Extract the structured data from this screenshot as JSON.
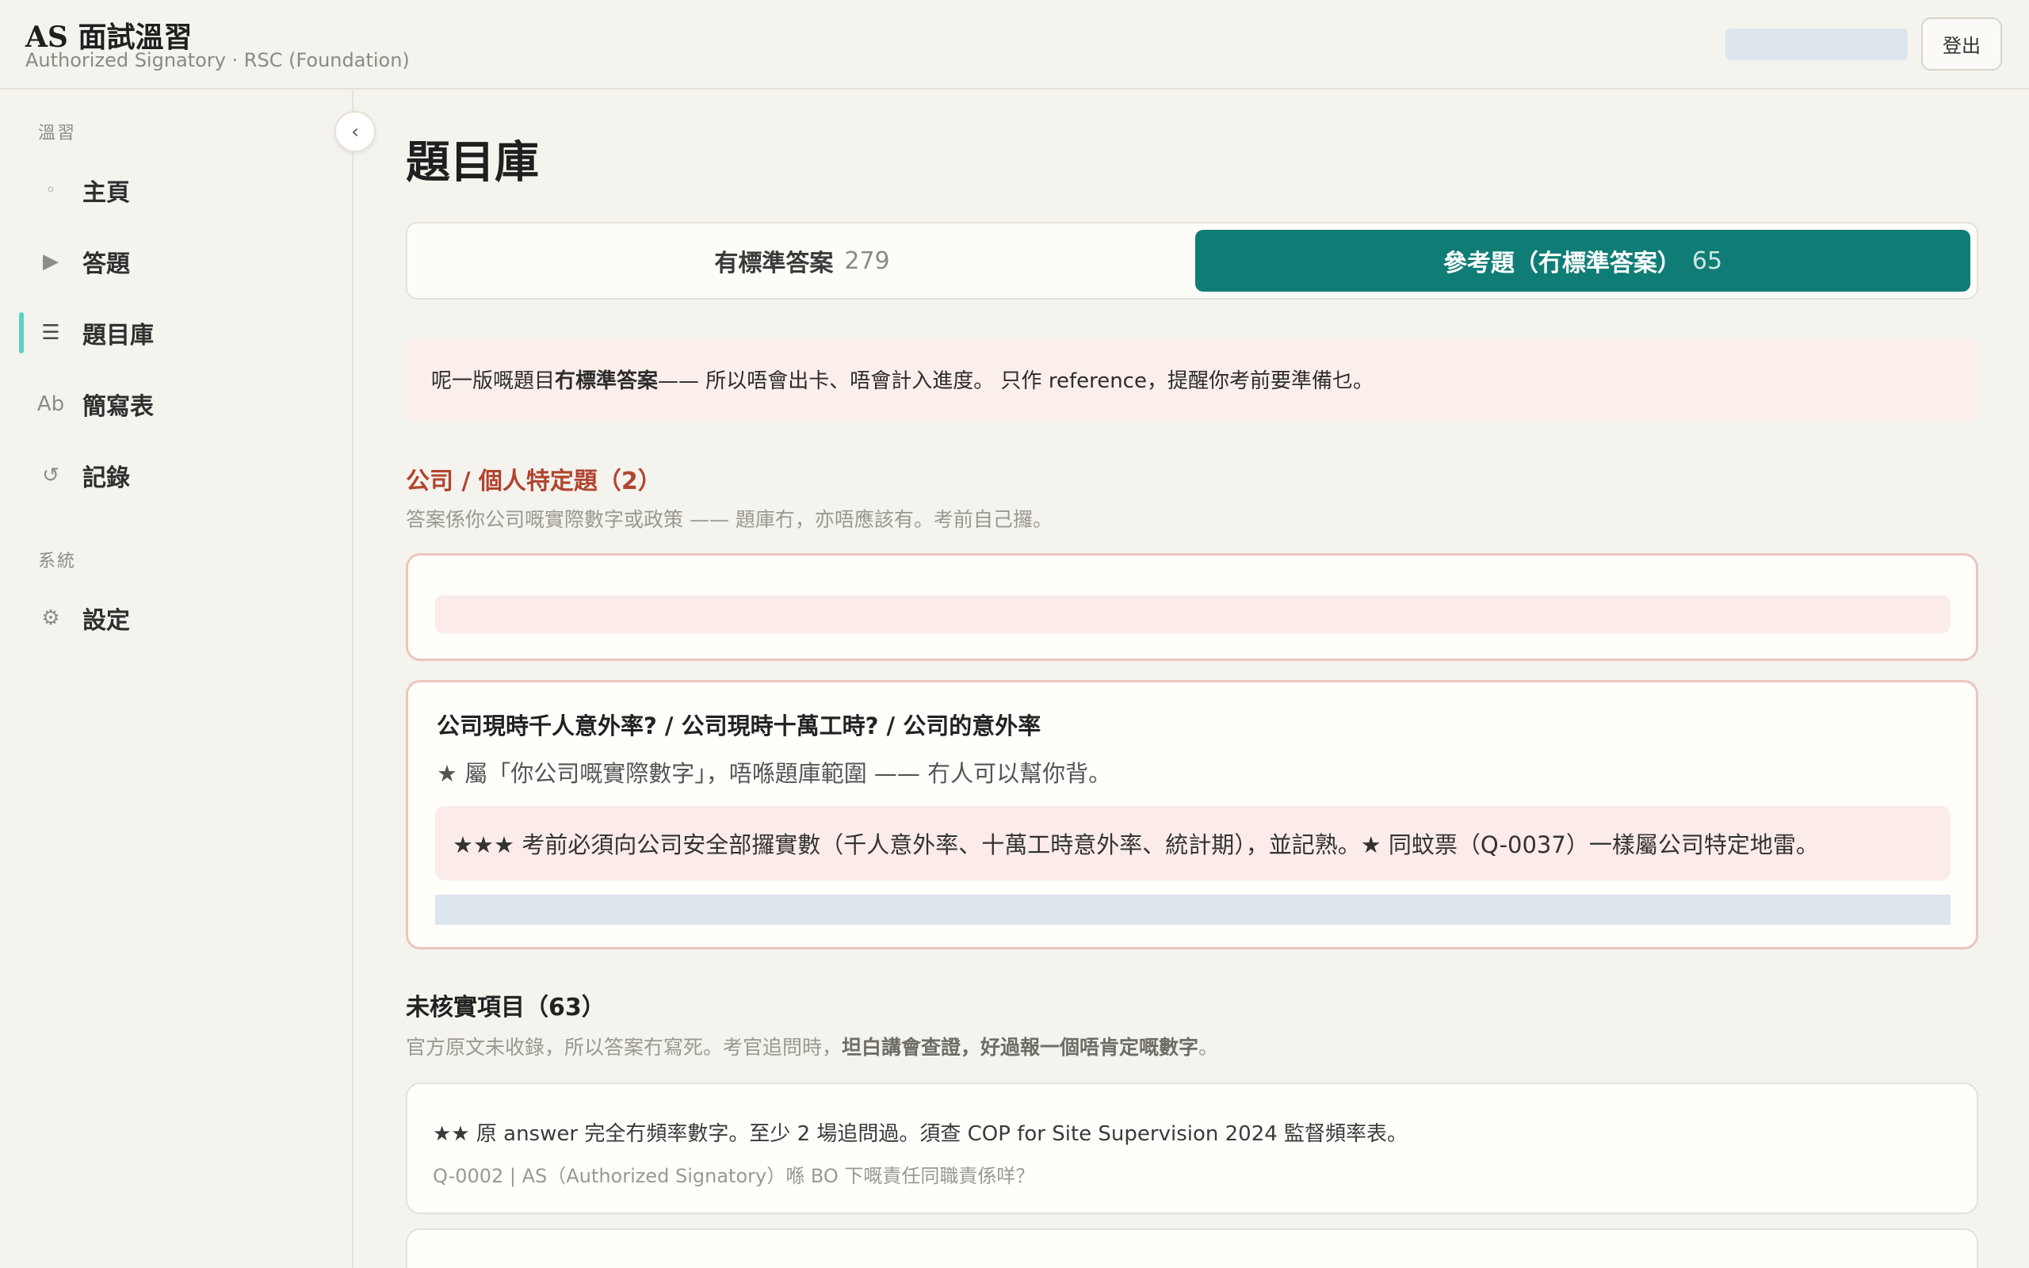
{
  "header": {
    "title": "AS 面試溫習",
    "subtitle": "Authorized Signatory · RSC (Foundation)",
    "logout_label": "登出"
  },
  "sidebar": {
    "section_review": "溫習",
    "section_system": "系統",
    "collapse_glyph": "‹",
    "items": [
      {
        "icon": "◦",
        "icon_name": "home-dot-icon",
        "label": "主頁"
      },
      {
        "icon": "▶",
        "icon_name": "play-icon",
        "label": "答題"
      },
      {
        "icon": "☰",
        "icon_name": "list-icon",
        "label": "題目庫"
      },
      {
        "icon": "Ab",
        "icon_name": "abbreviation-icon",
        "label": "簡寫表"
      },
      {
        "icon": "↺",
        "icon_name": "history-icon",
        "label": "記錄"
      },
      {
        "icon": "⚙",
        "icon_name": "gear-icon",
        "label": "設定"
      }
    ]
  },
  "main": {
    "page_title": "題目庫",
    "tabs": [
      {
        "label": "有標準答案",
        "count": "279",
        "active": false
      },
      {
        "label": "參考題（冇標準答案）",
        "count": "65",
        "active": true
      }
    ],
    "notice": {
      "prefix": "呢一版嘅題目",
      "bold": "冇標準答案",
      "suffix": " —— 所以唔會出卡、唔會計入進度。 只作 reference，提醒你考前要準備乜。"
    },
    "company_section": {
      "heading": "公司 / 個人特定題（2）",
      "subtitle": "答案係你公司嘅實際數字或政策 —— 題庫冇，亦唔應該有。考前自己攞。",
      "card": {
        "title": "公司現時千人意外率? / 公司現時十萬工時? / 公司的意外率",
        "note": "★ 屬「你公司嘅實際數字」，唔喺題庫範圍 —— 冇人可以幫你背。",
        "callout": "★★★ 考前必須向公司安全部攞實數（千人意外率、十萬工時意外率、統計期），並記熟。★ 同蚊票（Q-0037）一樣屬公司特定地雷。"
      }
    },
    "unverified_section": {
      "heading": "未核實項目（63）",
      "subtitle_prefix": "官方原文未收錄，所以答案冇寫死。考官追問時，",
      "subtitle_bold": "坦白講會查證，好過報一個唔肯定嘅數字",
      "subtitle_suffix": "。",
      "items": [
        {
          "note": "★★ 原 answer 完全冇頻率數字。至少 2 場追問過。須查 COP for Site Supervision 2024 監督頻率表。",
          "question": "Q-0002 | AS（Authorized Signatory）喺 BO 下嘅責任同職責係咩？"
        }
      ]
    }
  }
}
